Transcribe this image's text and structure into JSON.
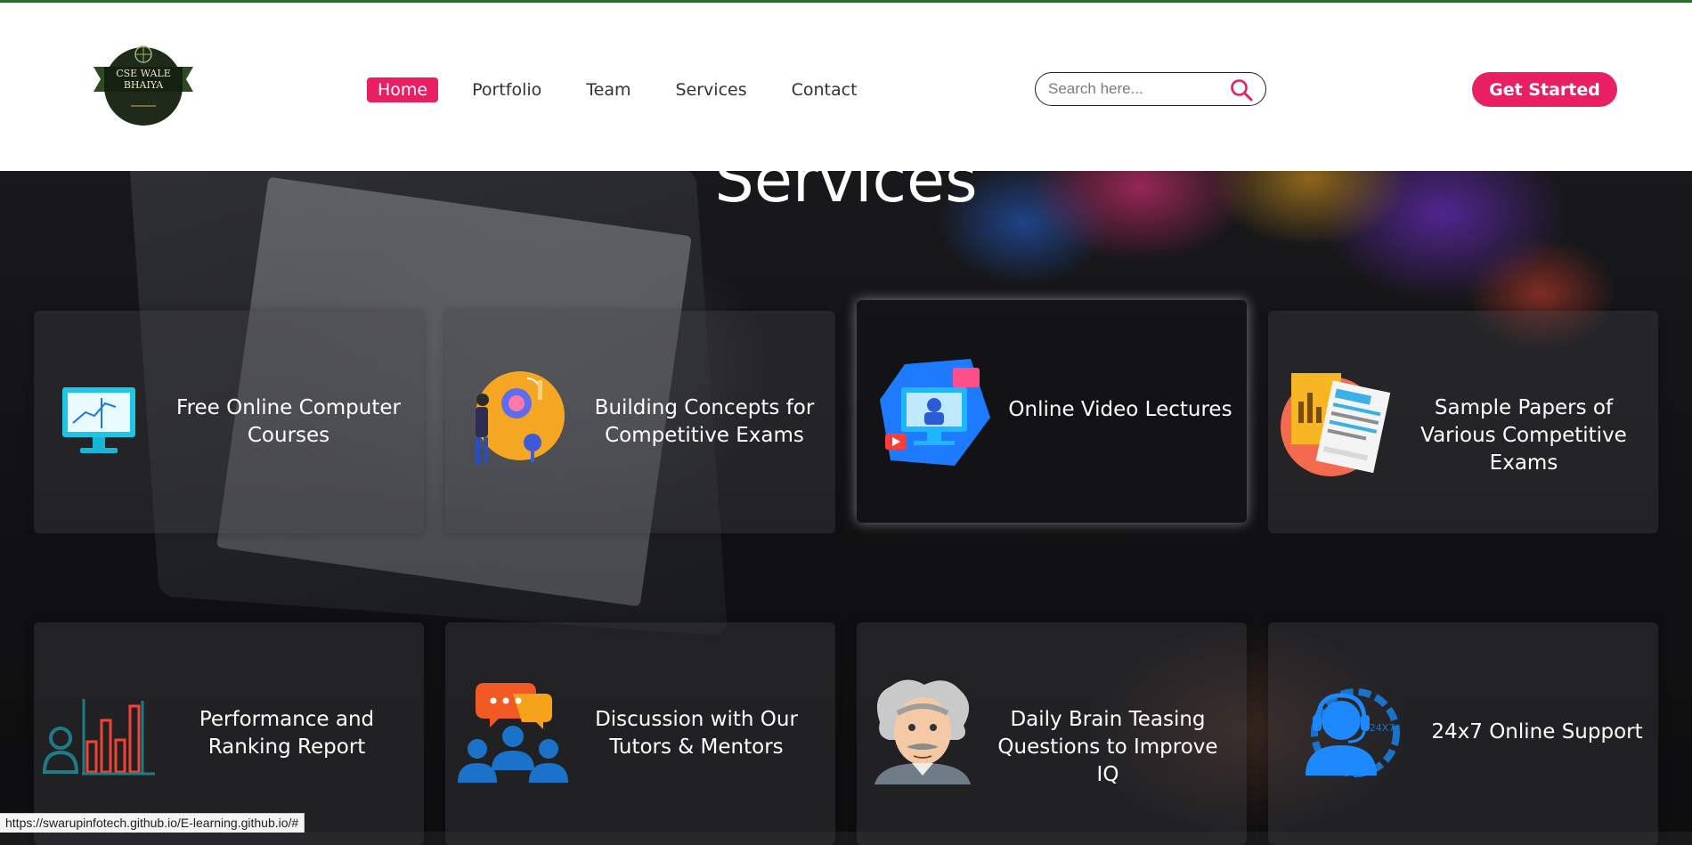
{
  "logo": {
    "line1": "CSE WALE",
    "line2": "BHAIYA"
  },
  "nav": {
    "items": [
      "Home",
      "Portfolio",
      "Team",
      "Services",
      "Contact"
    ],
    "active": "Home"
  },
  "search": {
    "placeholder": "Search here..."
  },
  "cta": {
    "label": "Get Started"
  },
  "section": {
    "title": "Services"
  },
  "services": [
    {
      "title": "Free Online Computer Courses",
      "icon": "monitor-chart-icon"
    },
    {
      "title": "Building Concepts for Competitive Exams",
      "icon": "brain-idea-icon"
    },
    {
      "title": "Online Video Lectures",
      "icon": "video-lecture-icon"
    },
    {
      "title": "Sample Papers of Various Competitive Exams",
      "icon": "papers-chart-icon"
    },
    {
      "title": "Performance and Ranking Report",
      "icon": "ranking-bars-icon"
    },
    {
      "title": "Discussion with Our Tutors & Mentors",
      "icon": "discussion-group-icon"
    },
    {
      "title": "Daily Brain Teasing Questions to Improve IQ",
      "icon": "einstein-icon"
    },
    {
      "title": "24x7 Online Support",
      "icon": "support-agent-icon"
    }
  ],
  "support_badge": "24X7 SUPPORT",
  "status_bar": {
    "url": "https://swarupinfotech.github.io/E-learning.github.io/#"
  },
  "colors": {
    "accent": "#e91e63",
    "header_bg": "#ffffff",
    "top_border": "#2a6a2a"
  }
}
